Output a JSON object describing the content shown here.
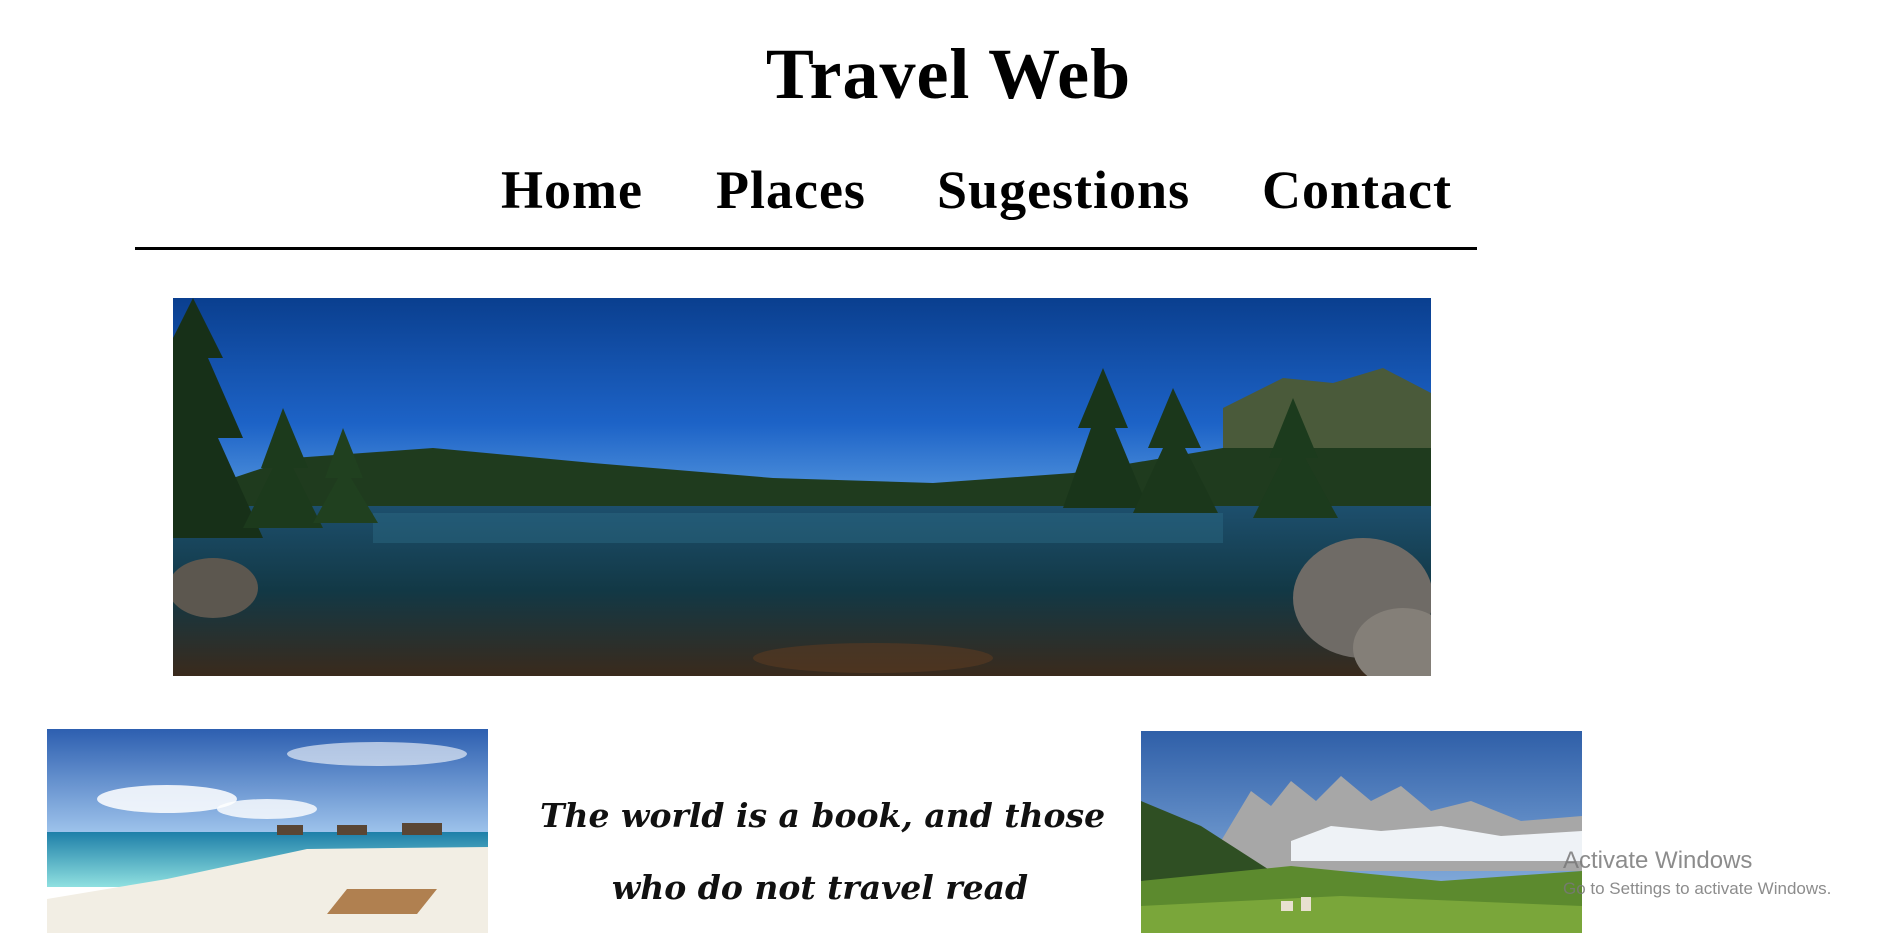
{
  "header": {
    "title": "Travel Web"
  },
  "nav": {
    "items": [
      {
        "label": "Home"
      },
      {
        "label": "Places"
      },
      {
        "label": "Sugestions"
      },
      {
        "label": "Contact"
      }
    ]
  },
  "images": {
    "hero": "lake-panorama-image",
    "left": "beach-bungalows-image",
    "right": "alpine-mountain-village-image"
  },
  "quote": {
    "line1": "The world is a book, and those",
    "line2": "who  do not travel read"
  },
  "os_watermark": {
    "title": "Activate Windows",
    "subtitle": "Go to Settings to activate Windows."
  }
}
